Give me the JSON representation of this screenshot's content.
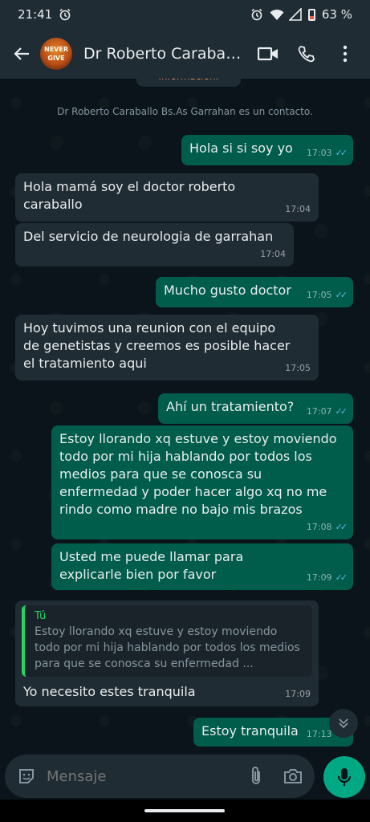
{
  "status_bar": {
    "time": "21:41",
    "battery": "63 %"
  },
  "header": {
    "contact_name": "Dr Roberto Caraballo Bs.As Garrahan",
    "avatar_text_top": "NEVER",
    "avatar_text_bottom": "GIVE"
  },
  "chat": {
    "partial_text": "información.",
    "system_note": "Dr Roberto Caraballo Bs.As Garrahan es un contacto.",
    "messages": [
      {
        "dir": "out",
        "text": "Hola si si soy yo",
        "time": "17:03",
        "ticks": "✓✓"
      },
      {
        "dir": "in",
        "text": "Hola mamá soy el doctor roberto caraballo",
        "time": "17:04"
      },
      {
        "dir": "in",
        "text": "Del servicio de neurologia de garrahan",
        "time": "17:04"
      },
      {
        "dir": "out",
        "text": "Mucho gusto doctor",
        "time": "17:05",
        "ticks": "✓✓"
      },
      {
        "dir": "in",
        "text": "Hoy tuvimos una reunion con el equipo de genetistas y creemos es posible hacer el tratamiento aqui",
        "time": "17:05"
      },
      {
        "dir": "out",
        "text": "Ahí un tratamiento?",
        "time": "17:07",
        "ticks": "✓✓"
      },
      {
        "dir": "out",
        "text": "Estoy llorando xq estuve y estoy moviendo todo por mi hija hablando por todos los medios para que se conosca su enfermedad y poder hacer algo xq no me rindo como madre no bajo mis brazos",
        "time": "17:08",
        "ticks": "✓✓"
      },
      {
        "dir": "out",
        "text": "Usted me puede llamar para explicarle bien por favor",
        "time": "17:09",
        "ticks": "✓✓"
      },
      {
        "dir": "in",
        "quote_author": "Tú",
        "quote_text": "Estoy llorando xq estuve y estoy moviendo todo por mi hija hablando por todos los medios para que se conosca su enfermedad ...",
        "text": "Yo necesito estes tranquila",
        "time": "17:09"
      },
      {
        "dir": "out",
        "text": "Estoy tranquila",
        "time": "17:13",
        "ticks": "✓✓"
      }
    ]
  },
  "composer": {
    "placeholder": "Mensaje"
  },
  "colors": {
    "incoming": "#202c33",
    "outgoing": "#005c4b",
    "accent": "#00a884",
    "read_ticks": "#53bdeb"
  }
}
